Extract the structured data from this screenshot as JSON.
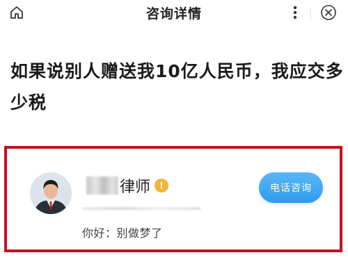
{
  "header": {
    "title": "咨询详情",
    "home_icon": "home-icon",
    "more_icon": "more-vertical-icon",
    "close_icon": "close-circle-icon"
  },
  "question": {
    "text": "如果说别人赠送我10亿人民币，我应交多少税"
  },
  "answer_card": {
    "highlight_color": "#c4121c",
    "lawyer_name": "律师",
    "verified_icon": "verified-badge-icon",
    "call_button_label": "电话咨询",
    "call_button_color": "#2f9bee",
    "reply_text": "你好：别做梦了"
  }
}
